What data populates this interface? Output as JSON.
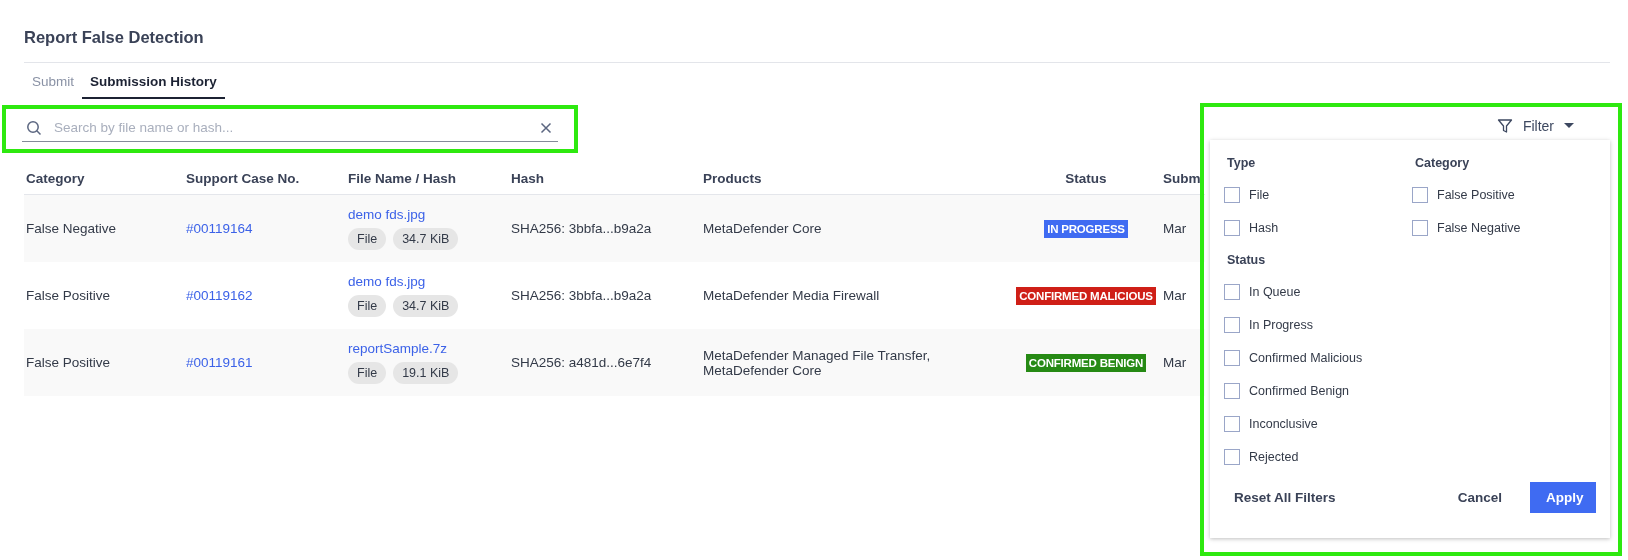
{
  "page_title": "Report False Detection",
  "tabs": [
    {
      "label": "Submit",
      "selected": false
    },
    {
      "label": "Submission History",
      "selected": true
    }
  ],
  "search": {
    "placeholder": "Search by file name or hash..."
  },
  "table": {
    "columns": [
      "Category",
      "Support Case No.",
      "File Name / Hash",
      "Hash",
      "Products",
      "Status",
      "Subm"
    ],
    "rows": [
      {
        "category": "False Negative",
        "case_no": "#00119164",
        "file_name": "demo fds.jpg",
        "tags": [
          "File",
          "34.7 KiB"
        ],
        "hash": "SHA256: 3bbfa...b9a2a",
        "products": [
          "MetaDefender Core"
        ],
        "status": {
          "label": "IN PROGRESS",
          "kind": "progress"
        },
        "column_7": "Mar"
      },
      {
        "category": "False Positive",
        "case_no": "#00119162",
        "file_name": "demo fds.jpg",
        "tags": [
          "File",
          "34.7 KiB"
        ],
        "hash": "SHA256: 3bbfa...b9a2a",
        "products": [
          "MetaDefender Media Firewall"
        ],
        "status": {
          "label": "CONFIRMED MALICIOUS",
          "kind": "malicious"
        },
        "column_7": "Mar"
      },
      {
        "category": "False Positive",
        "case_no": "#00119161",
        "file_name": "reportSample.7z",
        "tags": [
          "File",
          "19.1 KiB"
        ],
        "hash": "SHA256: a481d...6e7f4",
        "products": [
          "MetaDefender Managed File Transfer,",
          "MetaDefender Core"
        ],
        "status": {
          "label": "CONFIRMED BENIGN",
          "kind": "benign"
        },
        "column_7": "Mar"
      }
    ]
  },
  "filter": {
    "button_label": "Filter",
    "groups": [
      {
        "title": "Type",
        "options": [
          {
            "label": "File",
            "checked": false
          },
          {
            "label": "Hash",
            "checked": false
          }
        ]
      },
      {
        "title": "Category",
        "options": [
          {
            "label": "False Positive",
            "checked": false
          },
          {
            "label": "False Negative",
            "checked": false
          }
        ]
      },
      {
        "title": "Status",
        "options": [
          {
            "label": "In Queue",
            "checked": false
          },
          {
            "label": "In Progress",
            "checked": false
          },
          {
            "label": "Confirmed Malicious",
            "checked": false
          },
          {
            "label": "Confirmed Benign",
            "checked": false
          },
          {
            "label": "Inconclusive",
            "checked": false
          },
          {
            "label": "Rejected",
            "checked": false
          }
        ]
      }
    ],
    "reset_label": "Reset All Filters",
    "cancel_label": "Cancel",
    "apply_label": "Apply"
  }
}
